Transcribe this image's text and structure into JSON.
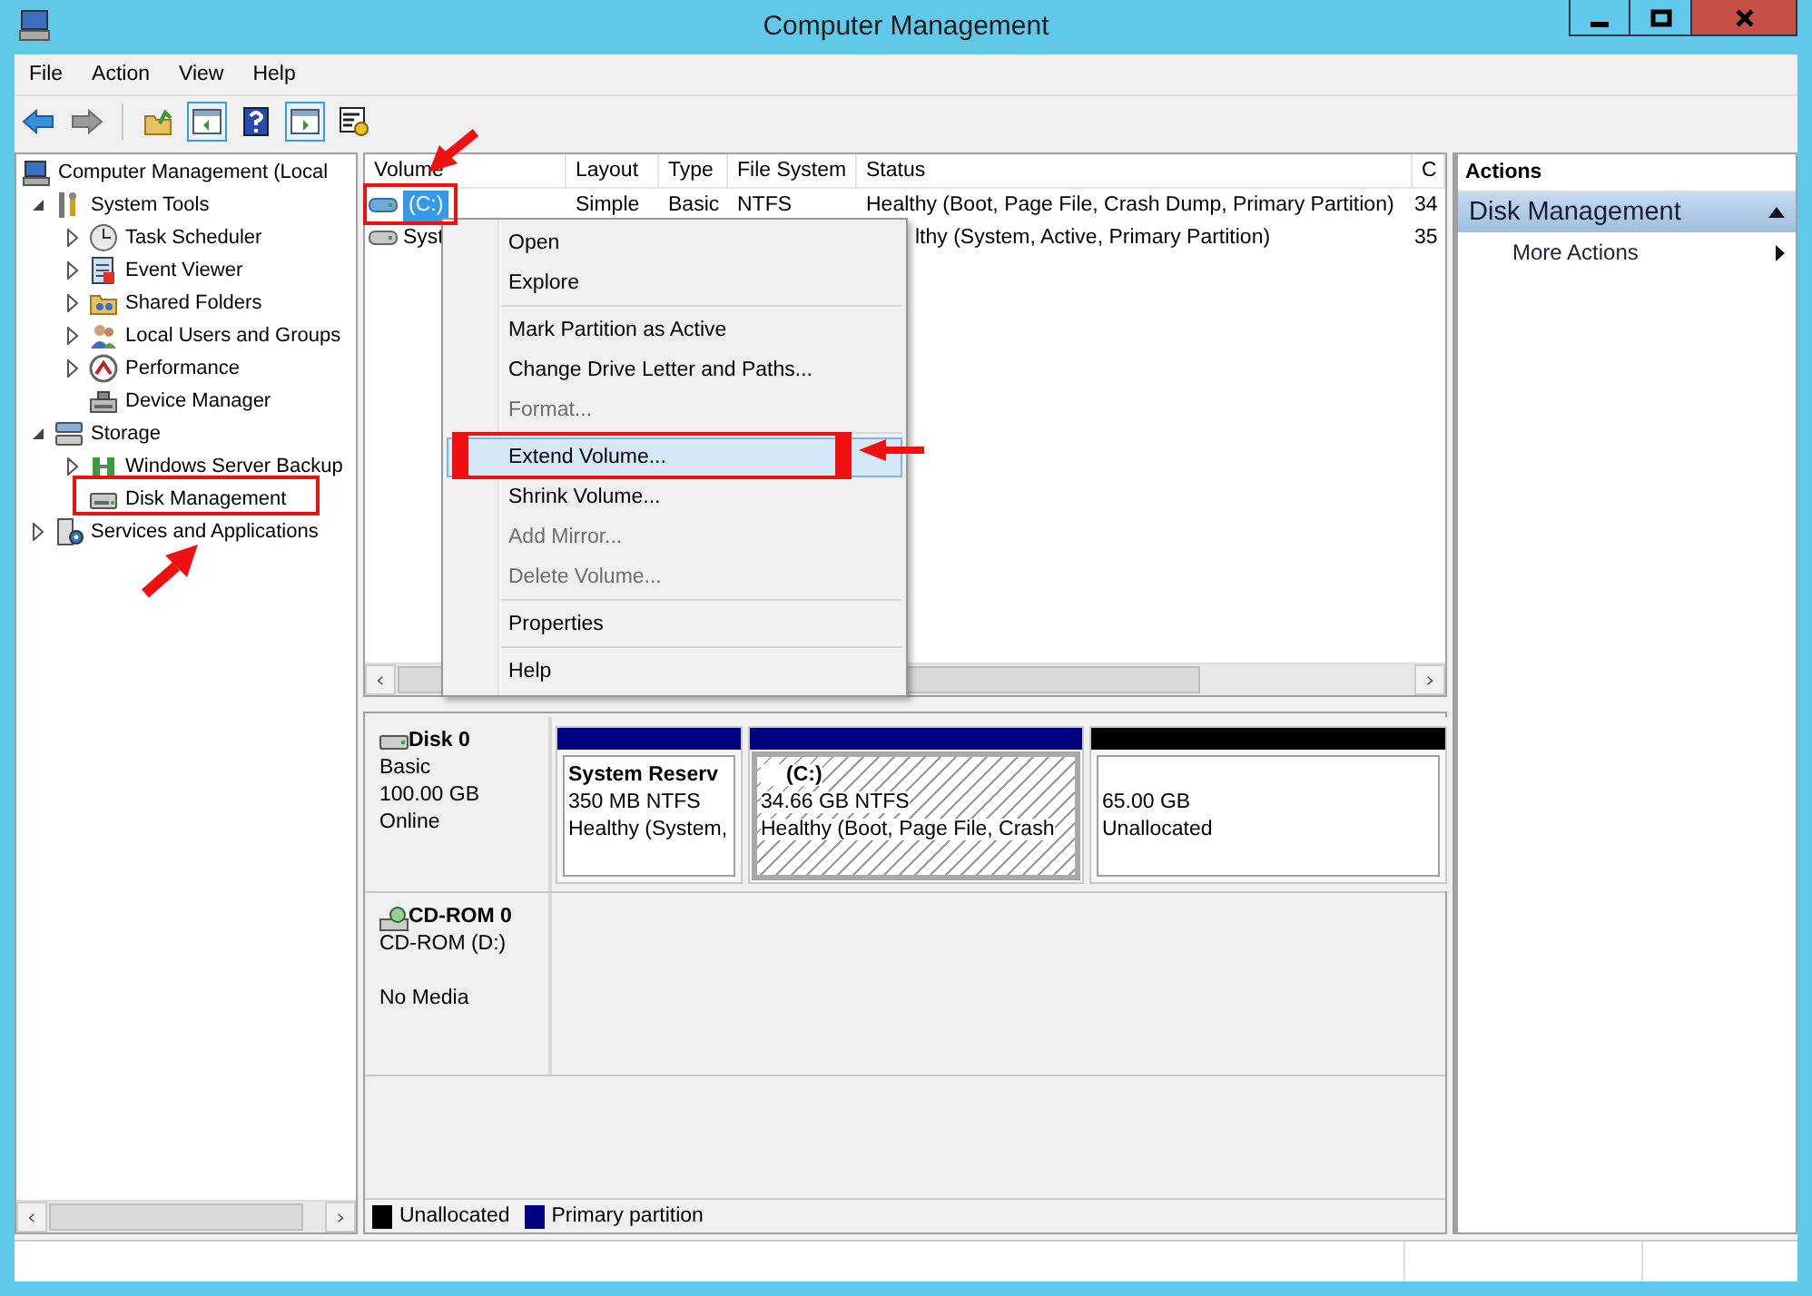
{
  "window": {
    "title": "Computer Management"
  },
  "menu_bar": [
    "File",
    "Action",
    "View",
    "Help"
  ],
  "tree": [
    {
      "label": "Computer Management (Local",
      "children": [
        {
          "label": "System Tools",
          "expanded": true,
          "children": [
            {
              "label": "Task Scheduler",
              "expanded": false
            },
            {
              "label": "Event Viewer",
              "expanded": false
            },
            {
              "label": "Shared Folders",
              "expanded": false
            },
            {
              "label": "Local Users and Groups",
              "expanded": false
            },
            {
              "label": "Performance",
              "expanded": false
            },
            {
              "label": "Device Manager"
            }
          ]
        },
        {
          "label": "Storage",
          "expanded": true,
          "children": [
            {
              "label": "Windows Server Backup",
              "expanded": false
            },
            {
              "label": "Disk Management"
            }
          ]
        },
        {
          "label": "Services and Applications",
          "expanded": false
        }
      ]
    }
  ],
  "volume_list": {
    "columns": [
      "Volume",
      "Layout",
      "Type",
      "File System",
      "Status",
      "C"
    ],
    "rows": [
      {
        "volume": "(C:)",
        "layout": "Simple",
        "type": "Basic",
        "file_system": "NTFS",
        "status": "Healthy (Boot, Page File, Crash Dump, Primary Partition)",
        "column_6": "34",
        "selected": true,
        "under_menu": false
      },
      {
        "volume": "Syst",
        "status": "lthy (System, Active, Primary Partition)",
        "column_6": "35",
        "selected": false,
        "under_menu": true
      }
    ]
  },
  "context_menu": [
    {
      "kind": "item",
      "label": "Open",
      "disabled": false,
      "selected": false
    },
    {
      "kind": "item",
      "label": "Explore",
      "disabled": false,
      "selected": false
    },
    {
      "kind": "separator"
    },
    {
      "kind": "item",
      "label": "Mark Partition as Active",
      "disabled": false,
      "selected": false
    },
    {
      "kind": "item",
      "label": "Change Drive Letter and Paths...",
      "disabled": false,
      "selected": false
    },
    {
      "kind": "item",
      "label": "Format...",
      "disabled": true,
      "selected": false
    },
    {
      "kind": "separator"
    },
    {
      "kind": "item",
      "label": "Extend Volume...",
      "disabled": false,
      "selected": true
    },
    {
      "kind": "item",
      "label": "Shrink Volume...",
      "disabled": false,
      "selected": false
    },
    {
      "kind": "item",
      "label": "Add Mirror...",
      "disabled": true,
      "selected": false
    },
    {
      "kind": "item",
      "label": "Delete Volume...",
      "disabled": true,
      "selected": false
    },
    {
      "kind": "separator"
    },
    {
      "kind": "item",
      "label": "Properties",
      "disabled": false,
      "selected": false
    },
    {
      "kind": "separator"
    },
    {
      "kind": "item",
      "label": "Help",
      "disabled": false,
      "selected": false
    }
  ],
  "disks": [
    {
      "kind": "disk",
      "name": "Disk 0",
      "type": "Basic",
      "size": "100.00 GB",
      "status": "Online",
      "partitions": [
        {
          "name": "System Reserv",
          "size": "350 MB NTFS",
          "status": "Healthy (System,",
          "color": "#000080",
          "selected": false
        },
        {
          "name": "(C:)",
          "size": "34.66 GB NTFS",
          "status": "Healthy (Boot, Page File, Crash",
          "color": "#000080",
          "selected": true
        },
        {
          "size": "65.00 GB",
          "status": "Unallocated",
          "color": "#000000",
          "selected": false
        }
      ]
    },
    {
      "kind": "cdrom",
      "name": "CD-ROM 0",
      "type": "CD-ROM (D:)",
      "status": "No Media"
    }
  ],
  "legend": [
    {
      "label": "Unallocated",
      "color": "#000000"
    },
    {
      "label": "Primary partition",
      "color": "#000080"
    }
  ],
  "actions": {
    "header": "Actions",
    "sections": [
      {
        "title": "Disk Management",
        "expanded": true,
        "items": [
          {
            "label": "More Actions",
            "submenu": true
          }
        ]
      }
    ]
  }
}
